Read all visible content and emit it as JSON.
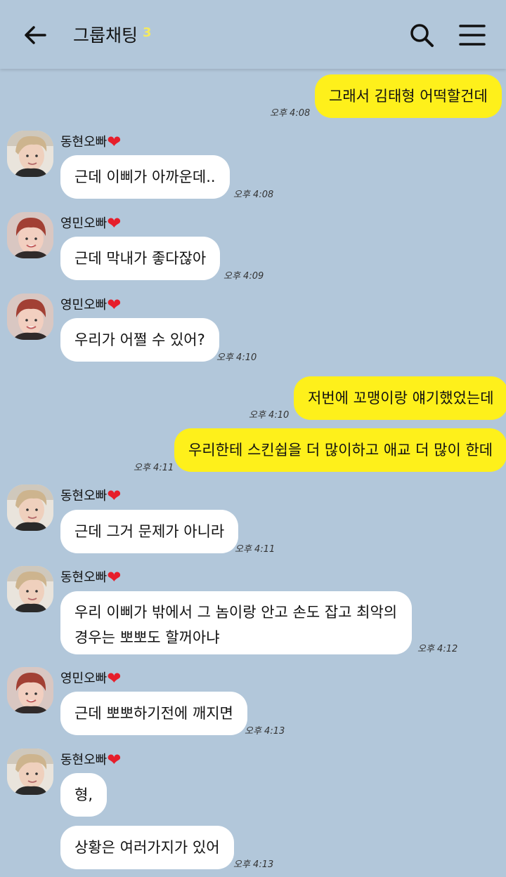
{
  "header": {
    "title": "그룹채팅",
    "member_count": "3"
  },
  "senders": {
    "donghyun": "동현오빠",
    "youngmin": "영민오빠"
  },
  "messages": [
    {
      "side": "out",
      "text": "그래서 김태형 어떡할건데",
      "time": "오후 4:08"
    },
    {
      "side": "in",
      "sender": "동현오빠",
      "text": "근데 이삐가 아까운데..",
      "time": "오후 4:08"
    },
    {
      "side": "in",
      "sender": "영민오빠",
      "text": "근데 막내가 좋다잖아",
      "time": "오후 4:09"
    },
    {
      "side": "in",
      "sender": "영민오빠",
      "text": "우리가 어쩔 수 있어?",
      "time": "오후 4:10"
    },
    {
      "side": "out",
      "text": "저번에 꼬맹이랑 얘기했었는데",
      "time": "오후 4:10"
    },
    {
      "side": "out",
      "text": "우리한테 스킨쉽을 더 많이하고 애교 더 많이 한데",
      "time": "오후 4:11"
    },
    {
      "side": "in",
      "sender": "동현오빠",
      "text": "근데 그거 문제가 아니라",
      "time": "오후 4:11"
    },
    {
      "side": "in",
      "sender": "동현오빠",
      "text": "우리 이삐가 밖에서 그 놈이랑 안고 손도 잡고 최악의 경우는 뽀뽀도 할꺼아냐",
      "time": "오후 4:12"
    },
    {
      "side": "in",
      "sender": "영민오빠",
      "text": "근데 뽀뽀하기전에 깨지면",
      "time": "오후 4:13"
    },
    {
      "side": "in",
      "sender": "동현오빠",
      "text": "형,",
      "time": ""
    },
    {
      "side": "in",
      "sender": "",
      "text": "상황은 여러가지가 있어",
      "time": "오후 4:13"
    }
  ]
}
